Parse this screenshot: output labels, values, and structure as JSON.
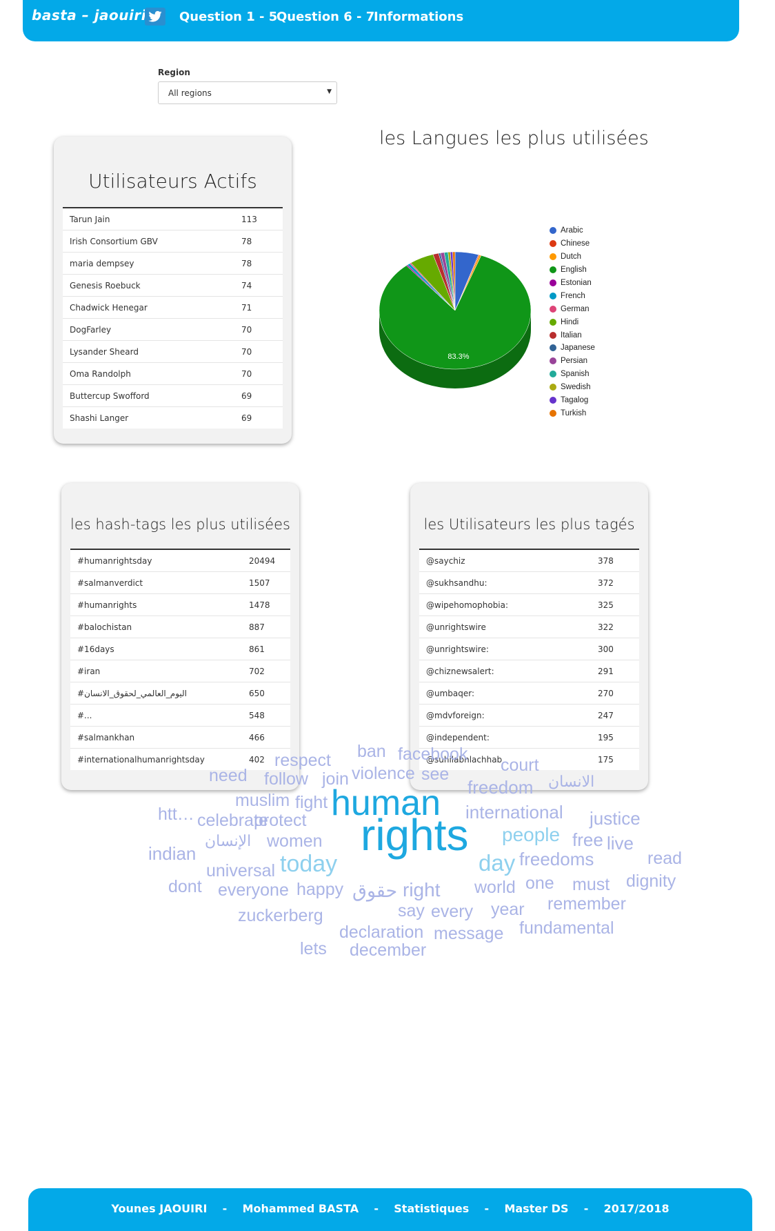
{
  "nav": {
    "brand": "basta – jaouiri",
    "links": [
      "Question 1 - 5",
      "Question 6 - 7",
      "Informations"
    ]
  },
  "filter": {
    "label": "Region",
    "value": "All regions"
  },
  "active_users": {
    "title": "Utilisateurs Actifs",
    "rows": [
      [
        "Tarun Jain",
        "113"
      ],
      [
        "Irish Consortium GBV",
        "78"
      ],
      [
        "maria dempsey",
        "78"
      ],
      [
        "Genesis Roebuck",
        "74"
      ],
      [
        "Chadwick Henegar",
        "71"
      ],
      [
        "DogFarley",
        "70"
      ],
      [
        "Lysander Sheard",
        "70"
      ],
      [
        "Oma Randolph",
        "70"
      ],
      [
        "Buttercup Swofford",
        "69"
      ],
      [
        "Shashi Langer",
        "69"
      ]
    ]
  },
  "chart_data": {
    "type": "pie",
    "title": "les Langues les plus utilisées",
    "slices": [
      {
        "name": "Arabic",
        "value": 5.0,
        "color": "#3366cc"
      },
      {
        "name": "Chinese",
        "value": 0.2,
        "color": "#dc3912"
      },
      {
        "name": "Dutch",
        "value": 0.4,
        "color": "#ff9900"
      },
      {
        "name": "English",
        "value": 83.3,
        "color": "#109618"
      },
      {
        "name": "Estonian",
        "value": 0.3,
        "color": "#990099"
      },
      {
        "name": "French",
        "value": 0.6,
        "color": "#0099c6"
      },
      {
        "name": "German",
        "value": 0.3,
        "color": "#dd4477"
      },
      {
        "name": "Hindi",
        "value": 5.2,
        "color": "#66aa00"
      },
      {
        "name": "Italian",
        "value": 1.2,
        "color": "#b82e2e"
      },
      {
        "name": "Japanese",
        "value": 0.4,
        "color": "#316395"
      },
      {
        "name": "Persian",
        "value": 0.8,
        "color": "#994499"
      },
      {
        "name": "Spanish",
        "value": 0.8,
        "color": "#22aa99"
      },
      {
        "name": "Swedish",
        "value": 0.5,
        "color": "#aaaa11"
      },
      {
        "name": "Tagalog",
        "value": 0.5,
        "color": "#6633cc"
      },
      {
        "name": "Turkish",
        "value": 0.5,
        "color": "#e67300"
      }
    ],
    "labels": [
      "83.3%"
    ],
    "legend": "right"
  },
  "hashtags": {
    "title": "les hash-tags les plus utilisées",
    "rows": [
      [
        "#humanrightsday",
        "20494"
      ],
      [
        "#salmanverdict",
        "1507"
      ],
      [
        "#humanrights",
        "1478"
      ],
      [
        "#balochistan",
        "887"
      ],
      [
        "#16days",
        "861"
      ],
      [
        "#iran",
        "702"
      ],
      [
        "#اليوم_العالمي_لحقوق_الانسان",
        "650"
      ],
      [
        "#...",
        "548"
      ],
      [
        "#salmankhan",
        "466"
      ],
      [
        "#internationalhumanrightsday",
        "402"
      ]
    ]
  },
  "tagged_users": {
    "title": "les Utilisateurs les plus tagés",
    "rows": [
      [
        "@saychiz",
        "378"
      ],
      [
        "@sukhsandhu:",
        "372"
      ],
      [
        "@wipehomophobia:",
        "325"
      ],
      [
        "@unrightswire",
        "322"
      ],
      [
        "@unrightswire:",
        "300"
      ],
      [
        "@chiznewsalert:",
        "291"
      ],
      [
        "@umbaqer:",
        "270"
      ],
      [
        "@mdvforeign:",
        "247"
      ],
      [
        "@independent:",
        "195"
      ],
      [
        "@suhilabnlachhab",
        "175"
      ]
    ]
  },
  "word_cloud": {
    "words": [
      "respect",
      "ban",
      "facebook",
      "need",
      "follow",
      "join",
      "violence",
      "see",
      "court",
      "freedom",
      "الانسان",
      "muslim",
      "fight",
      "human",
      "htt…",
      "celebrate",
      "protect",
      "international",
      "justice",
      "people",
      "indian",
      "الإنسان",
      "women",
      "rights",
      "free",
      "live",
      "universal",
      "today",
      "day",
      "freedoms",
      "read",
      "dont",
      "everyone",
      "happy",
      "حقوق",
      "right",
      "world",
      "one",
      "must",
      "dignity",
      "zuckerberg",
      "say",
      "every",
      "year",
      "remember",
      "declaration",
      "message",
      "fundamental",
      "lets",
      "december"
    ],
    "colors": {
      "accent": "#1ea8e0",
      "light": "#8ed0ee",
      "muted": "#aab4e6"
    }
  },
  "footer": {
    "text": "Younes JAOUIRI    -    Mohammed BASTA    -    Statistiques    -    Master DS    -    2017/2018"
  }
}
